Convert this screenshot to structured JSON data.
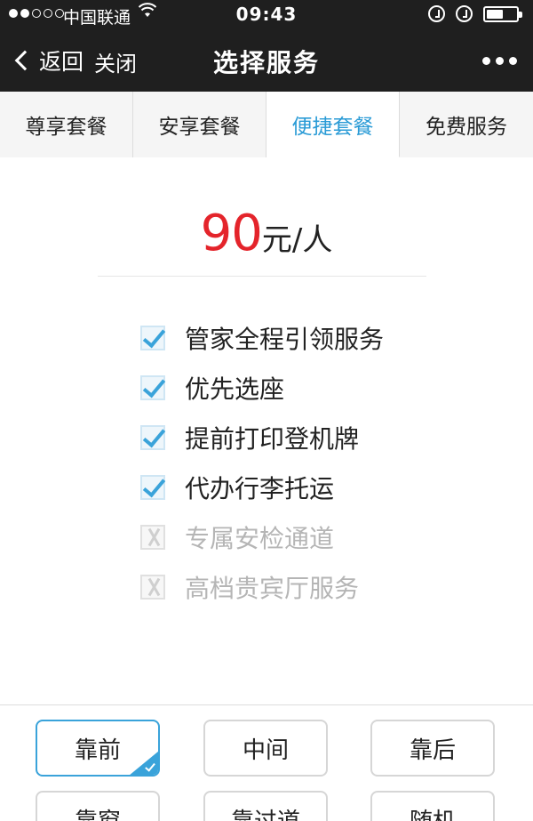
{
  "status_bar": {
    "carrier": "中国联通",
    "time": "09:43"
  },
  "nav": {
    "back_label": "返回",
    "close_label": "关闭",
    "title": "选择服务"
  },
  "tabs": [
    {
      "label": "尊享套餐",
      "active": false
    },
    {
      "label": "安享套餐",
      "active": false
    },
    {
      "label": "便捷套餐",
      "active": true
    },
    {
      "label": "免费服务",
      "active": false
    }
  ],
  "price": {
    "amount": "90",
    "unit": "元/人"
  },
  "features": [
    {
      "label": "管家全程引领服务",
      "included": true
    },
    {
      "label": "优先选座",
      "included": true
    },
    {
      "label": "提前打印登机牌",
      "included": true
    },
    {
      "label": "代办行李托运",
      "included": true
    },
    {
      "label": "专属安检通道",
      "included": false
    },
    {
      "label": "高档贵宾厅服务",
      "included": false
    }
  ],
  "seat_options": [
    {
      "label": "靠前",
      "selected": true
    },
    {
      "label": "中间",
      "selected": false
    },
    {
      "label": "靠后",
      "selected": false
    },
    {
      "label": "靠窗",
      "selected": false
    },
    {
      "label": "靠过道",
      "selected": false
    },
    {
      "label": "随机",
      "selected": false
    }
  ],
  "colors": {
    "accent": "#2a9bd6",
    "price": "#e4242b",
    "topbar": "#1f1f1f"
  }
}
